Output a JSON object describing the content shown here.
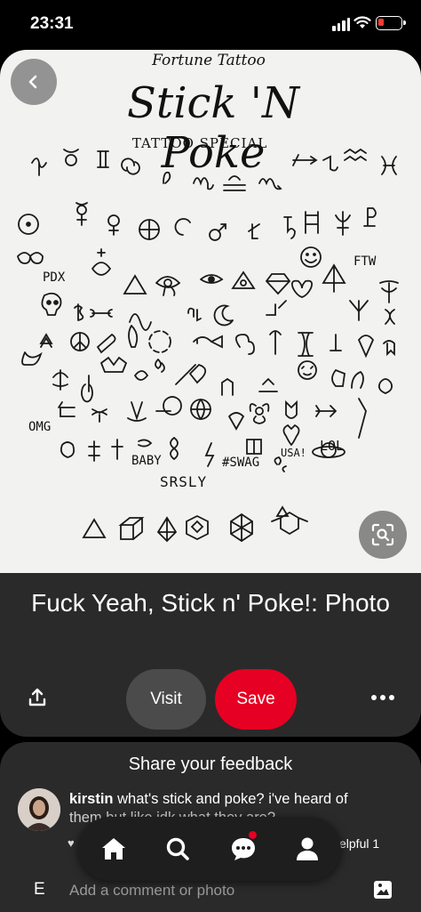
{
  "status_bar": {
    "time": "23:31"
  },
  "image": {
    "brand": "Fortune Tattoo",
    "title": "Stick 'N Poke",
    "subtitle": "TATTOO SPECIAL",
    "words": [
      "PDX",
      "FTW",
      "OMG",
      "BABY",
      "#SWAG",
      "USA!",
      "LOL",
      "SRSLY"
    ]
  },
  "pin": {
    "title": "Fuck Yeah, Stick n' Poke!: Photo",
    "visit_label": "Visit",
    "save_label": "Save"
  },
  "feedback": {
    "title": "Share your feedback",
    "comment_user": "kirstin",
    "comment_text_1": " what's stick and poke? i've heard of",
    "comment_text_2": "them but like idk what they are?",
    "helpful_label": "elpful 1"
  },
  "comment_bar": {
    "initial": "E",
    "placeholder": "Add a comment or photo"
  },
  "colors": {
    "save_red": "#e60023",
    "panel_dark": "#2a2a2a",
    "battery_low": "#ff3b30"
  },
  "icons": [
    "back-arrow-icon",
    "visual-search-icon",
    "share-icon",
    "more-icon",
    "home-icon",
    "search-icon",
    "messages-icon",
    "profile-icon",
    "image-icon"
  ]
}
